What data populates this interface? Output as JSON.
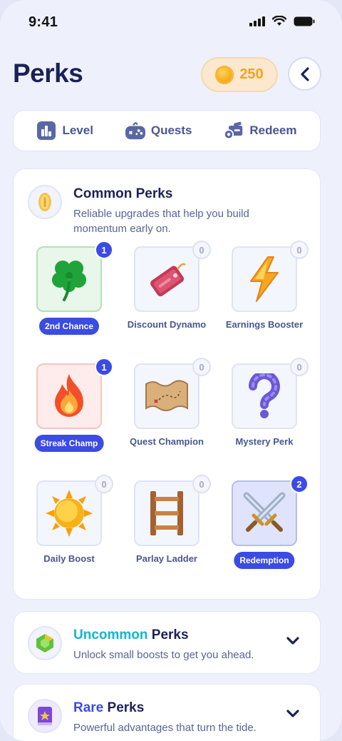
{
  "status": {
    "time": "9:41"
  },
  "header": {
    "title": "Perks",
    "coins": "250"
  },
  "tabs": [
    {
      "label": "Level",
      "icon": "bar-chart-icon"
    },
    {
      "label": "Quests",
      "icon": "gamepad-icon"
    },
    {
      "label": "Redeem",
      "icon": "redeem-icon"
    }
  ],
  "common": {
    "title": "Common Perks",
    "subtitle": "Reliable upgrades that help you build momentum early on.",
    "perks": [
      {
        "label": "2nd Chance",
        "count": "1",
        "icon": "clover-icon"
      },
      {
        "label": "Discount Dynamo",
        "count": "0",
        "icon": "tag-icon"
      },
      {
        "label": "Earnings Booster",
        "count": "0",
        "icon": "lightning-icon"
      },
      {
        "label": "Streak Champ",
        "count": "1",
        "icon": "flame-icon"
      },
      {
        "label": "Quest Champion",
        "count": "0",
        "icon": "map-icon"
      },
      {
        "label": "Mystery Perk",
        "count": "0",
        "icon": "question-icon"
      },
      {
        "label": "Daily Boost",
        "count": "0",
        "icon": "sun-icon"
      },
      {
        "label": "Parlay Ladder",
        "count": "0",
        "icon": "ladder-icon"
      },
      {
        "label": "Redemption",
        "count": "2",
        "icon": "swords-icon"
      }
    ]
  },
  "uncommon": {
    "title_accent": "Uncommon",
    "title_rest": " Perks",
    "subtitle": "Unlock small boosts to get you ahead.",
    "accent_color": "#14b4cf"
  },
  "rare": {
    "title_accent": "Rare",
    "title_rest": " Perks",
    "subtitle": "Powerful advantages that turn the tide.",
    "accent_color": "#3b4be3"
  },
  "colors": {
    "primary": "#3b4be3",
    "navy": "#1b2157",
    "coin": "#f0a41d"
  }
}
